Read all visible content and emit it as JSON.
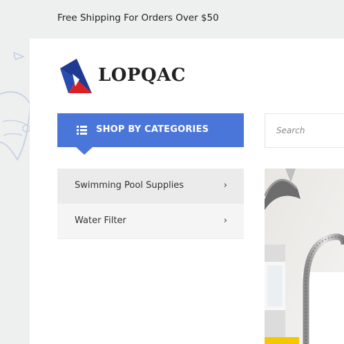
{
  "topbar": {
    "shipping_text": "Free Shipping For Orders Over $50"
  },
  "logo": {
    "text": "LOPQAC",
    "mark_colors": [
      "#1f3a93",
      "#d92027",
      "#ffffff"
    ]
  },
  "categories": {
    "button_label": "SHOP BY CATEGORIES",
    "button_icon": "list-icon",
    "accent_color": "#4b76d9",
    "items": [
      {
        "label": "Swimming Pool Supplies",
        "chevron": "›"
      },
      {
        "label": "Water Filter",
        "chevron": "›"
      }
    ]
  },
  "search": {
    "placeholder": "Search"
  },
  "hero": {
    "image": "kitchen-faucet-photo"
  }
}
